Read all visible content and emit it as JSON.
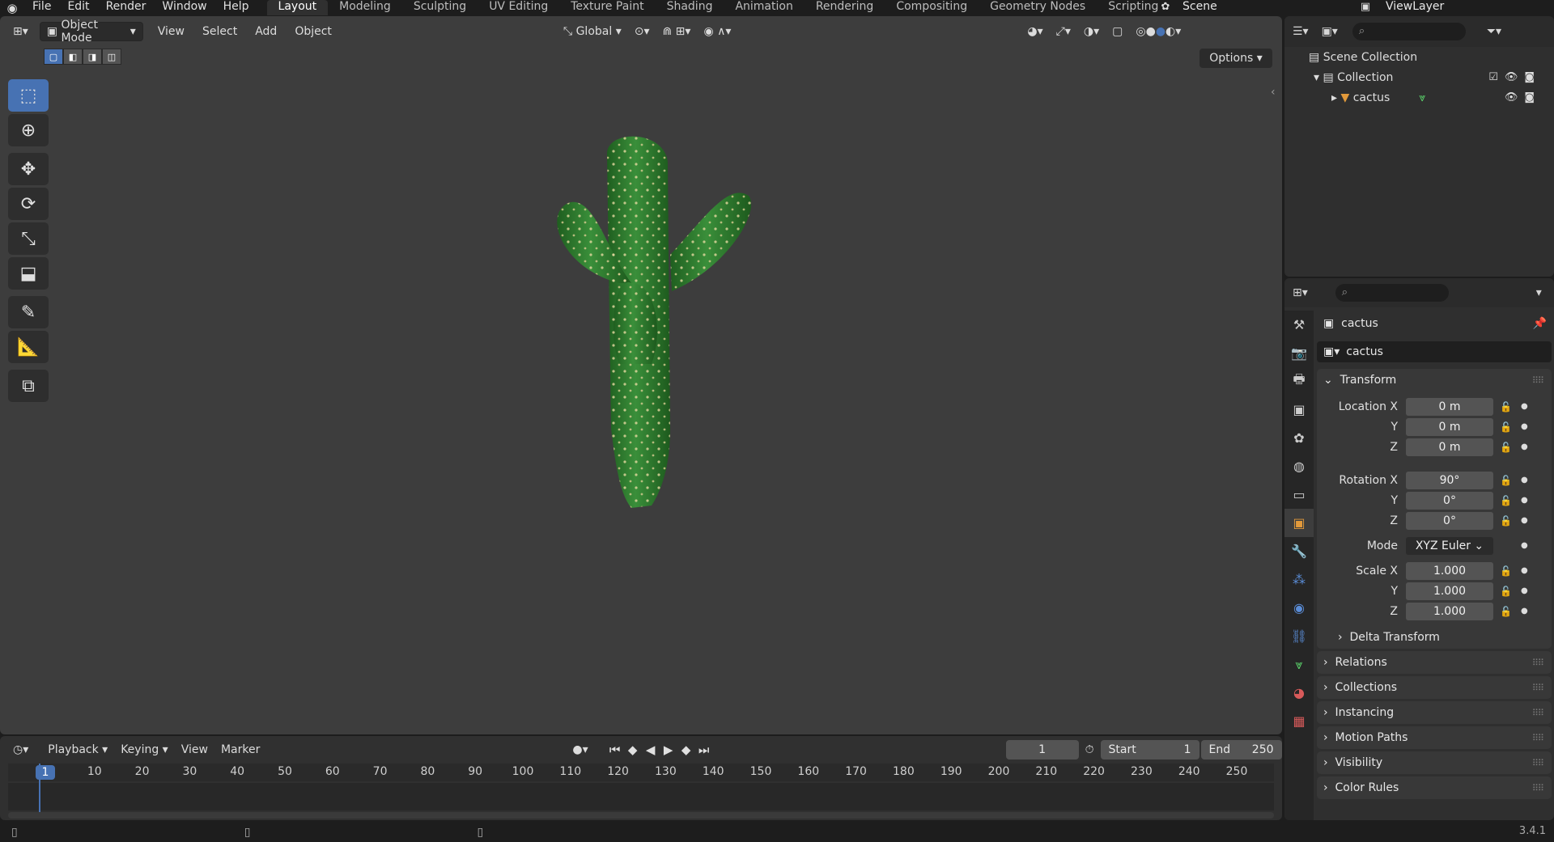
{
  "topbar": {
    "menus": [
      "File",
      "Edit",
      "Render",
      "Window",
      "Help"
    ],
    "tabs": [
      "Layout",
      "Modeling",
      "Sculpting",
      "UV Editing",
      "Texture Paint",
      "Shading",
      "Animation",
      "Rendering",
      "Compositing",
      "Geometry Nodes",
      "Scripting"
    ],
    "active_tab": "Layout",
    "scene": "Scene",
    "view_layer": "ViewLayer"
  },
  "viewport": {
    "mode": "Object Mode",
    "menus": [
      "View",
      "Select",
      "Add",
      "Object"
    ],
    "orientation": "Global",
    "options_label": "Options"
  },
  "timeline": {
    "menus": [
      "Playback",
      "Keying",
      "View",
      "Marker"
    ],
    "current_frame": "1",
    "start_label": "Start",
    "start": "1",
    "end_label": "End",
    "end": "250",
    "ruler": [
      "10",
      "20",
      "30",
      "40",
      "50",
      "60",
      "70",
      "80",
      "90",
      "100",
      "110",
      "120",
      "130",
      "140",
      "150",
      "160",
      "170",
      "180",
      "190",
      "200",
      "210",
      "220",
      "230",
      "240",
      "250"
    ]
  },
  "outliner": {
    "scene_collection": "Scene Collection",
    "collection": "Collection",
    "object": "cactus"
  },
  "properties": {
    "object_title": "cactus",
    "object_name": "cactus",
    "transform_label": "Transform",
    "location_label": "Location X",
    "rotation_label": "Rotation X",
    "mode_label": "Mode",
    "scale_label": "Scale X",
    "y_label": "Y",
    "z_label": "Z",
    "location": [
      "0 m",
      "0 m",
      "0 m"
    ],
    "rotation": [
      "90°",
      "0°",
      "0°"
    ],
    "rotation_mode": "XYZ Euler",
    "scale": [
      "1.000",
      "1.000",
      "1.000"
    ],
    "delta_transform": "Delta Transform",
    "sections": [
      "Relations",
      "Collections",
      "Instancing",
      "Motion Paths",
      "Visibility",
      "Color Rules"
    ]
  },
  "status": {
    "version": "3.4.1"
  },
  "colors": {
    "accent": "#4772b3",
    "viewport_bg": "#3d3d3d",
    "cactus": "#2e7d2e"
  }
}
